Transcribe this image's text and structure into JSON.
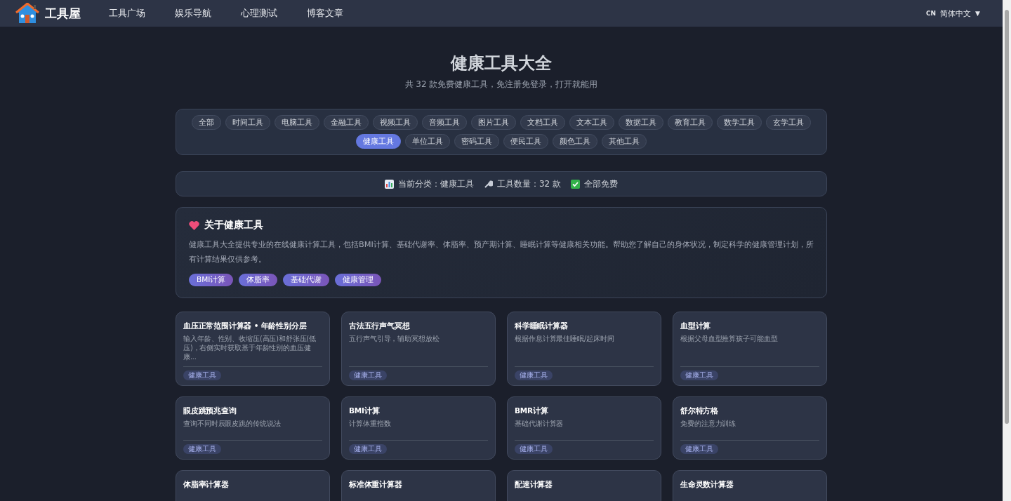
{
  "nav": {
    "brand": "工具屋",
    "links": [
      "工具广场",
      "娱乐导航",
      "心理测试",
      "博客文章"
    ],
    "language": {
      "code": "CN",
      "label": "简体中文",
      "caret": "▼"
    }
  },
  "hero": {
    "title": "健康工具大全",
    "subtitle": "共 32 款免费健康工具，免注册免登录，打开就能用"
  },
  "categories": [
    {
      "label": "全部",
      "selected": false
    },
    {
      "label": "时间工具",
      "selected": false
    },
    {
      "label": "电脑工具",
      "selected": false
    },
    {
      "label": "金融工具",
      "selected": false
    },
    {
      "label": "视频工具",
      "selected": false
    },
    {
      "label": "音频工具",
      "selected": false
    },
    {
      "label": "图片工具",
      "selected": false
    },
    {
      "label": "文档工具",
      "selected": false
    },
    {
      "label": "文本工具",
      "selected": false
    },
    {
      "label": "数据工具",
      "selected": false
    },
    {
      "label": "教育工具",
      "selected": false
    },
    {
      "label": "数学工具",
      "selected": false
    },
    {
      "label": "玄学工具",
      "selected": false
    },
    {
      "label": "健康工具",
      "selected": true
    },
    {
      "label": "单位工具",
      "selected": false
    },
    {
      "label": "密码工具",
      "selected": false
    },
    {
      "label": "便民工具",
      "selected": false
    },
    {
      "label": "颜色工具",
      "selected": false
    },
    {
      "label": "其他工具",
      "selected": false
    }
  ],
  "stats": [
    {
      "kind": "chart",
      "text": "当前分类：健康工具"
    },
    {
      "kind": "wrench",
      "text": "工具数量：32 款"
    },
    {
      "kind": "check",
      "text": "全部免费"
    }
  ],
  "about": {
    "title": "关于健康工具",
    "text": "健康工具大全提供专业的在线健康计算工具，包括BMI计算、基础代谢率、体脂率、预产期计算、睡眠计算等健康相关功能。帮助您了解自己的身体状况，制定科学的健康管理计划，所有计算结果仅供参考。",
    "tags": [
      "BMI计算",
      "体脂率",
      "基础代谢",
      "健康管理"
    ]
  },
  "tools": [
    {
      "title": "血压正常范围计算器 • 年龄性别分层",
      "description": "输入年龄、性别、收缩压(高压)和舒张压(低压)，右侧实时获取基于年龄性别的血压健康...",
      "tag": "健康工具"
    },
    {
      "title": "古法五行声气冥想",
      "description": "五行声气引导，辅助冥想放松",
      "tag": "健康工具"
    },
    {
      "title": "科学睡眠计算器",
      "description": "根据作息计算最佳睡眠/起床时间",
      "tag": "健康工具"
    },
    {
      "title": "血型计算",
      "description": "根据父母血型推算孩子可能血型",
      "tag": "健康工具"
    },
    {
      "title": "眼皮跳预兆查询",
      "description": "查询不同时辰眼皮跳的传统说法",
      "tag": "健康工具"
    },
    {
      "title": "BMI计算",
      "description": "计算体重指数",
      "tag": "健康工具"
    },
    {
      "title": "BMR计算",
      "description": "基础代谢计算器",
      "tag": "健康工具"
    },
    {
      "title": "舒尔特方格",
      "description": "免费的注意力训练",
      "tag": "健康工具"
    },
    {
      "title": "体脂率计算器"
    },
    {
      "title": "标准体重计算器"
    },
    {
      "title": "配速计算器"
    },
    {
      "title": "生命灵数计算器"
    }
  ]
}
